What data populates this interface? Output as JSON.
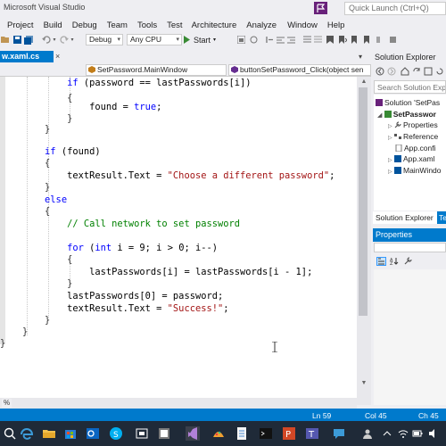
{
  "window": {
    "title": "Microsoft Visual Studio",
    "quick_launch_placeholder": "Quick Launch (Ctrl+Q)"
  },
  "menu": [
    "Project",
    "Build",
    "Debug",
    "Team",
    "Tools",
    "Test",
    "Architecture",
    "Analyze",
    "Window",
    "Help"
  ],
  "toolbar": {
    "config": "Debug",
    "platform": "Any CPU",
    "start_label": "Start"
  },
  "editor_tab": {
    "filename": "w.xaml.cs",
    "close_glyph": "×"
  },
  "navbar": {
    "class_member": "SetPassword.MainWindow",
    "method": "buttonSetPassword_Click(object sen"
  },
  "code": [
    "            if (password == lastPasswords[i])",
    "            {",
    "                found = true;",
    "            }",
    "        }",
    "",
    "        if (found)",
    "        {",
    "            textResult.Text = \"Choose a different password\";",
    "        }",
    "        else",
    "        {",
    "            // Call network to set password",
    "",
    "            for (int i = 9; i > 0; i--)",
    "            {",
    "                lastPasswords[i] = lastPasswords[i - 1];",
    "            }",
    "            lastPasswords[0] = password;",
    "            textResult.Text = \"Success!\";",
    "        }",
    "    }",
    "}"
  ],
  "zoom": "%",
  "solution_explorer": {
    "title": "Solution Explorer",
    "search_placeholder": "Search Solution Explo",
    "items": [
      {
        "label": "Solution 'SetPas",
        "icon": "solution-icon"
      },
      {
        "label": "SetPasswor",
        "icon": "csharp-project-icon"
      },
      {
        "label": "Properties",
        "icon": "wrench-icon"
      },
      {
        "label": "Reference",
        "icon": "references-icon"
      },
      {
        "label": "App.confi",
        "icon": "config-file-icon"
      },
      {
        "label": "App.xaml",
        "icon": "xaml-file-icon"
      },
      {
        "label": "MainWindo",
        "icon": "xaml-file-icon"
      }
    ],
    "tab_active": "Solution Explorer",
    "tab_other": "Te"
  },
  "properties": {
    "title": "Properties"
  },
  "status": {
    "line": "Ln 59",
    "col": "Col 45",
    "ch": "Ch 45"
  },
  "colors": {
    "accent": "#007acc",
    "keyword": "#0000ff",
    "string": "#a31515",
    "comment": "#008000"
  }
}
